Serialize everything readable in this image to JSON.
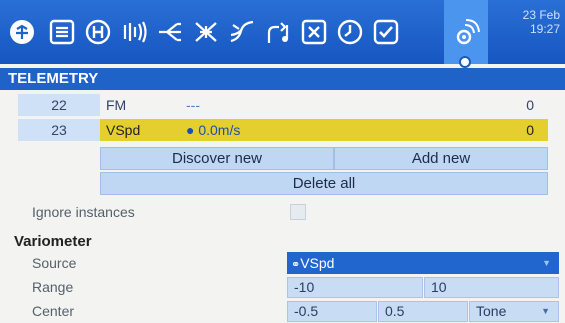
{
  "status_bar": {
    "date": "23 Feb",
    "time": "19:27",
    "icons": [
      "radio-model-icon",
      "list-icon",
      "home-h-icon",
      "signal-wave-icon",
      "mixer-icon",
      "cross-arrows-icon",
      "curves-icon",
      "logic-switch-icon",
      "special-function-icon",
      "timer-icon",
      "checklist-icon",
      "telemetry-icon"
    ]
  },
  "section": {
    "title": "TELEMETRY"
  },
  "sensors": [
    {
      "index": "22",
      "name": "FM",
      "value": "---",
      "count": "0"
    },
    {
      "index": "23",
      "name": "VSpd",
      "value": "● 0.0m/s",
      "count": "0"
    }
  ],
  "buttons": {
    "discover": "Discover new",
    "add": "Add new",
    "delete_all": "Delete all"
  },
  "settings": {
    "ignore_instances_label": "Ignore instances",
    "group_title": "Variometer",
    "source_label": "Source",
    "source_value": "VSpd",
    "range_label": "Range",
    "range_min": "-10",
    "range_max": "10",
    "center_label": "Center",
    "center_min": "-0.5",
    "center_max": "0.5",
    "center_mode": "Tone"
  },
  "colors": {
    "accent": "#1f63c8",
    "selected_row": "#e4cf2f",
    "button_bg": "#bfd7f3"
  }
}
